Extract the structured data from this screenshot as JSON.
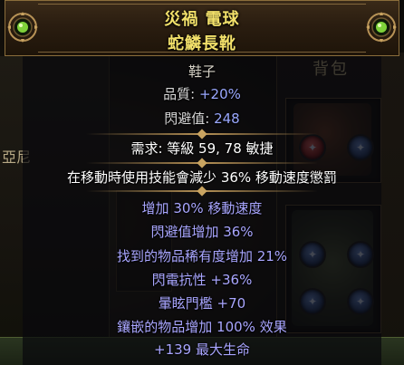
{
  "background": {
    "inventory_title": "背包",
    "side_label": "亞尼",
    "faded_label": "背包"
  },
  "item": {
    "name": "災禍 電球",
    "base_type": "蛇鱗長靴",
    "category": "鞋子",
    "quality_label": "品質: ",
    "quality_value": "+20%",
    "evasion_label": "閃避值: ",
    "evasion_value": "248",
    "requirement": "需求: 等級 59, 78 敏捷",
    "implicit": "在移動時使用技能會減少 36% 移動速度懲罰",
    "mods": [
      "增加 30% 移動速度",
      "閃避值增加 36%",
      "找到的物品稀有度增加 21%",
      "閃電抗性 +36%",
      "暈眩門檻 +70",
      "鑲嵌的物品增加 100% 效果",
      "+139 最大生命"
    ]
  },
  "colors": {
    "name": "#f2e06a",
    "magic_mod": "#a9a6ff",
    "value": "#9aa8ff",
    "frame": "#b79256"
  },
  "icons": {
    "ornament_left": "green-jewel-ornament-icon",
    "ornament_right": "green-jewel-ornament-icon"
  }
}
